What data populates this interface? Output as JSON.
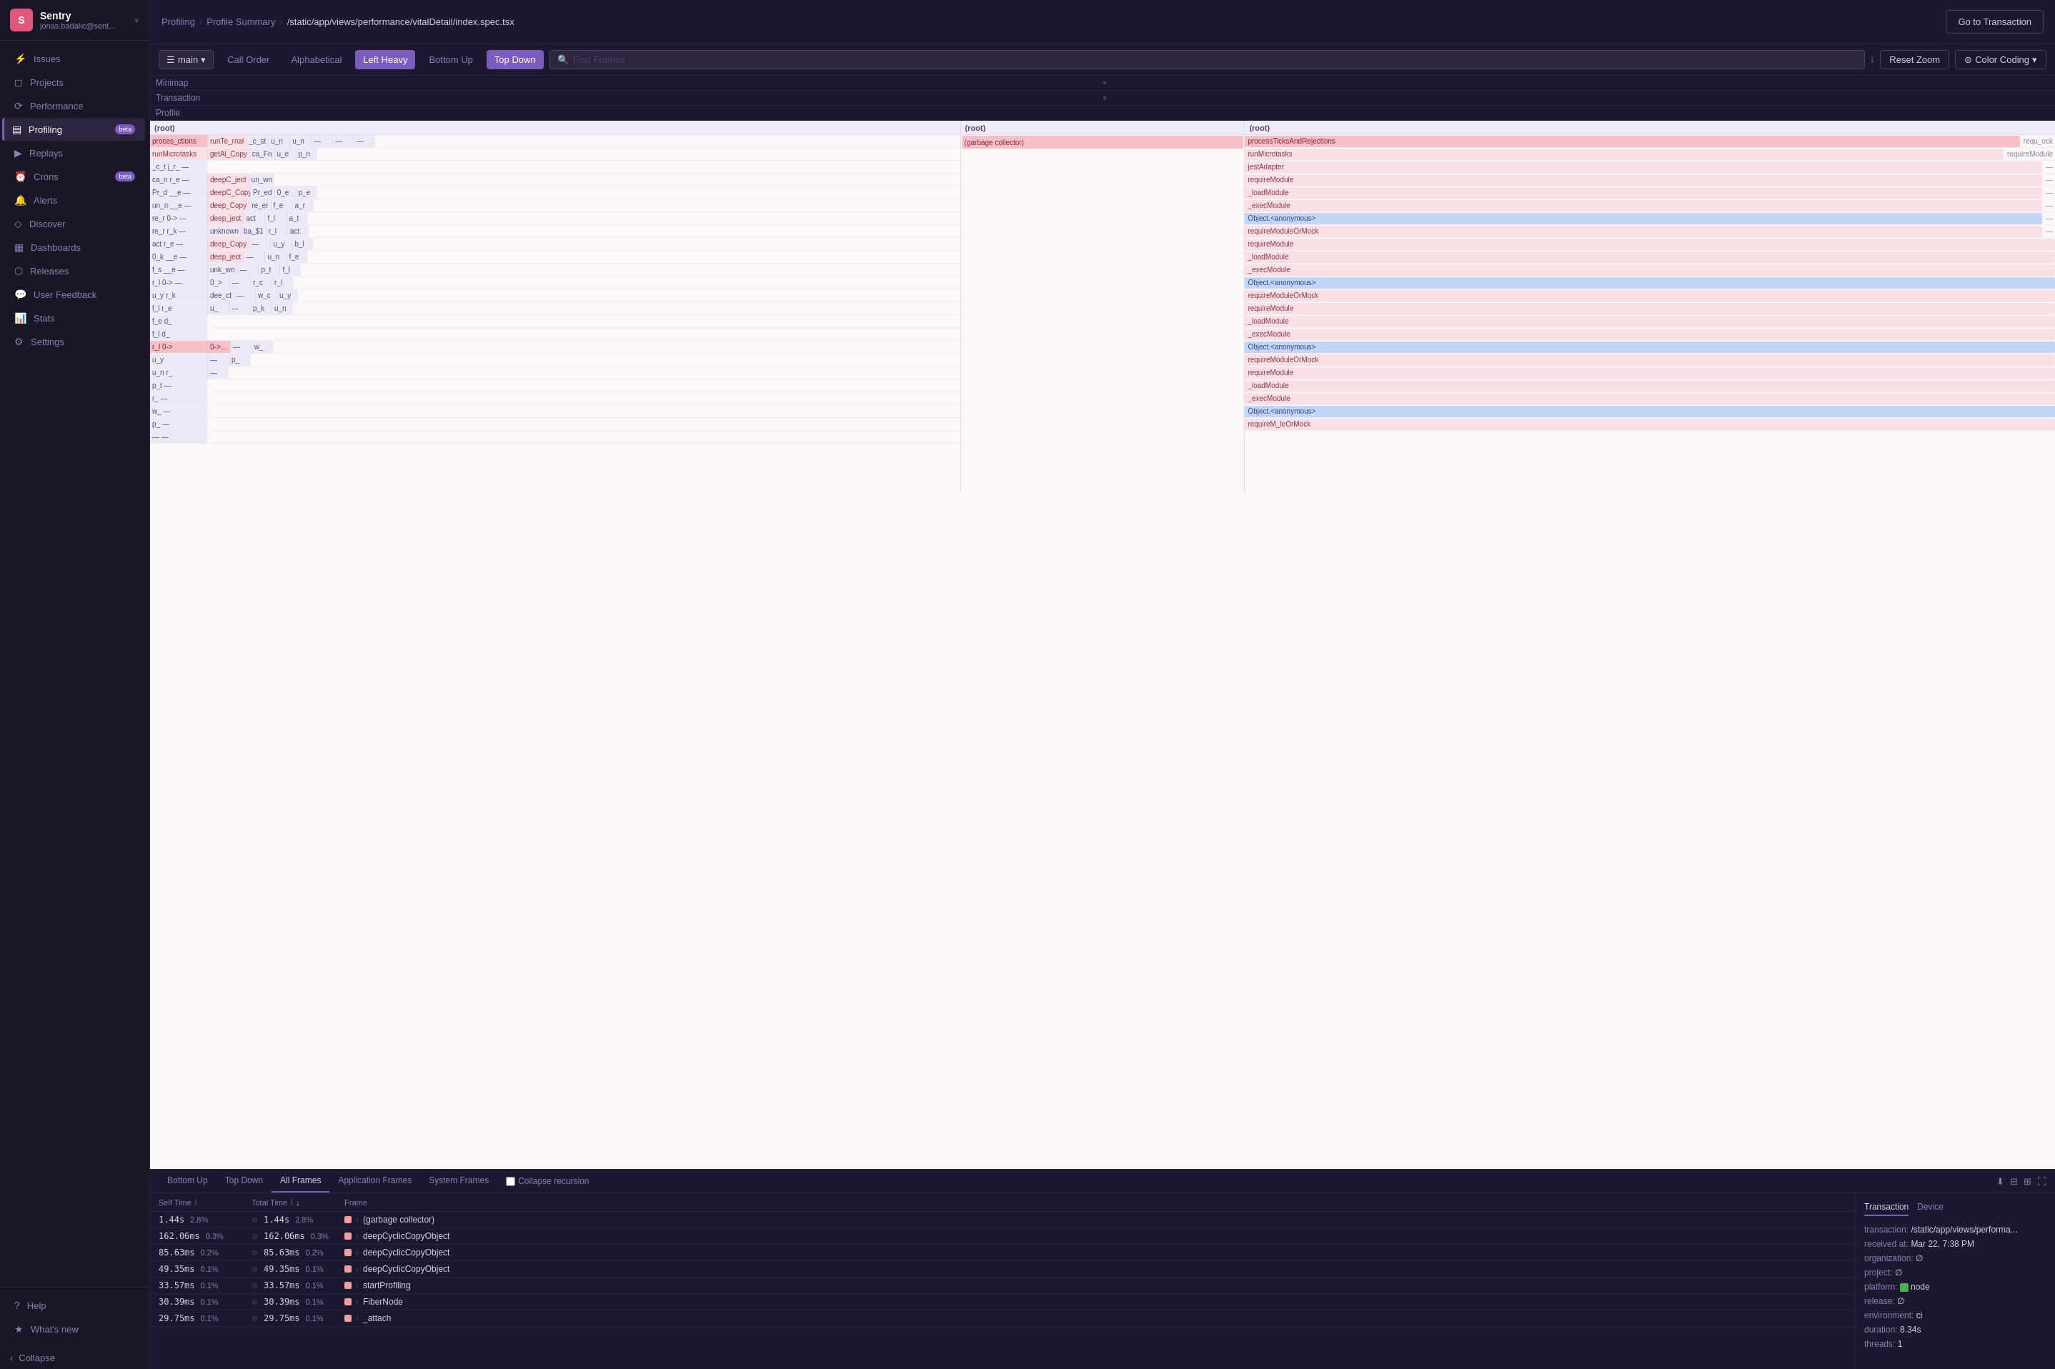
{
  "app": {
    "logo": "S",
    "org_name": "Sentry",
    "org_email": "jonas.badalic@sent..."
  },
  "sidebar": {
    "items": [
      {
        "id": "issues",
        "label": "Issues",
        "icon": "⚡",
        "active": false
      },
      {
        "id": "projects",
        "label": "Projects",
        "icon": "◻",
        "active": false
      },
      {
        "id": "performance",
        "label": "Performance",
        "icon": "⟳",
        "active": false
      },
      {
        "id": "profiling",
        "label": "Profiling",
        "icon": "▤",
        "active": true,
        "badge": "beta"
      },
      {
        "id": "replays",
        "label": "Replays",
        "icon": "▶",
        "active": false
      },
      {
        "id": "crons",
        "label": "Crons",
        "icon": "⏰",
        "active": false,
        "badge": "beta"
      },
      {
        "id": "alerts",
        "label": "Alerts",
        "icon": "🔔",
        "active": false
      },
      {
        "id": "discover",
        "label": "Discover",
        "icon": "◇",
        "active": false
      },
      {
        "id": "dashboards",
        "label": "Dashboards",
        "icon": "▦",
        "active": false
      },
      {
        "id": "releases",
        "label": "Releases",
        "icon": "⬡",
        "active": false
      },
      {
        "id": "user-feedback",
        "label": "User Feedback",
        "icon": "💬",
        "active": false
      },
      {
        "id": "stats",
        "label": "Stats",
        "icon": "📊",
        "active": false
      },
      {
        "id": "settings",
        "label": "Settings",
        "icon": "⚙",
        "active": false
      }
    ],
    "footer": [
      {
        "id": "help",
        "label": "Help",
        "icon": "?"
      },
      {
        "id": "whats-new",
        "label": "What's new",
        "icon": "★"
      }
    ],
    "collapse_label": "Collapse"
  },
  "breadcrumb": {
    "items": [
      "Profiling",
      "Profile Summary"
    ],
    "current": "/static/app/views/performance/vitalDetail/index.spec.tsx"
  },
  "goto_button": "Go to Transaction",
  "toolbar": {
    "select_value": "main",
    "buttons": [
      {
        "id": "call-order",
        "label": "Call Order",
        "active": false
      },
      {
        "id": "alphabetical",
        "label": "Alphabetical",
        "active": false
      },
      {
        "id": "left-heavy",
        "label": "Left Heavy",
        "active": true
      },
      {
        "id": "bottom-up",
        "label": "Bottom Up",
        "active": false
      },
      {
        "id": "top-down",
        "label": "Top Down",
        "active": true
      }
    ],
    "search_placeholder": "Find Frames",
    "reset_zoom": "Reset Zoom",
    "color_coding": "Color Coding"
  },
  "flamegraph_sections": [
    {
      "label": "Minimap",
      "expanded": true
    },
    {
      "label": "Transaction",
      "expanded": true
    },
    {
      "label": "Profile",
      "expanded": true
    }
  ],
  "flame_columns": [
    {
      "id": "col1",
      "header": "(root)",
      "rows": [
        {
          "label": "proces_ctions",
          "style": "fb-pink",
          "width": 95
        },
        {
          "label": "runMicrotasks",
          "style": "fb-light-pink",
          "width": 90
        },
        {
          "label": "_c_t j_r_",
          "style": "fb-gray",
          "width": 30
        },
        {
          "label": "ca_n r_e _",
          "style": "fb-gray",
          "width": 30
        },
        {
          "label": "Pr_d __e _",
          "style": "fb-gray",
          "width": 30
        },
        {
          "label": "un_n __e _",
          "style": "fb-gray",
          "width": 30
        },
        {
          "label": "re_r 0->",
          "style": "fb-gray",
          "width": 30
        },
        {
          "label": "re_r r_k _",
          "style": "fb-gray",
          "width": 30
        },
        {
          "label": "act r_e _",
          "style": "fb-gray",
          "width": 30
        },
        {
          "label": "0_k __e _",
          "style": "fb-gray",
          "width": 30
        },
        {
          "label": "f_s __e _",
          "style": "fb-gray",
          "width": 30
        },
        {
          "label": "r_l 0->",
          "style": "fb-gray",
          "width": 30
        },
        {
          "label": "u_y r_k",
          "style": "fb-gray",
          "width": 30
        },
        {
          "label": "f_l r_e",
          "style": "fb-gray",
          "width": 30
        },
        {
          "label": "f_e e_ d_",
          "style": "fb-gray",
          "width": 30
        },
        {
          "label": "f_l __e d_",
          "style": "fb-gray",
          "width": 30
        },
        {
          "label": "r_l 0->",
          "style": "fb-pink",
          "width": 60
        },
        {
          "label": "u_y r_k",
          "style": "fb-gray",
          "width": 30
        },
        {
          "label": "u_n r_ _",
          "style": "fb-gray",
          "width": 30
        },
        {
          "label": "p_t __",
          "style": "fb-gray",
          "width": 30
        },
        {
          "label": "r_ __",
          "style": "fb-gray",
          "width": 30
        },
        {
          "label": "w_ __",
          "style": "fb-gray",
          "width": 30
        },
        {
          "label": "p_ __",
          "style": "fb-gray",
          "width": 30
        },
        {
          "label": "__ __",
          "style": "fb-gray",
          "width": 30
        }
      ]
    },
    {
      "id": "col2",
      "header": "(root) (garbage collector)",
      "rows": [
        {
          "label": "(garbage collector)",
          "style": "fb-pink",
          "width": 95
        }
      ]
    },
    {
      "id": "col3",
      "header": "(root)",
      "rows": [
        {
          "label": "processTicksAndRejections",
          "style": "fb-pink",
          "width": 95
        },
        {
          "label": "runMicrotasks",
          "style": "fb-light-pink",
          "width": 90
        },
        {
          "label": "jestAdapter",
          "style": "fb-light-pink",
          "width": 85
        },
        {
          "label": "requireModule",
          "style": "fb-light-pink",
          "width": 80
        },
        {
          "label": "_loadModule",
          "style": "fb-light-pink",
          "width": 75
        },
        {
          "label": "_execModule",
          "style": "fb-light-pink",
          "width": 70
        },
        {
          "label": "Object.<anonymous>",
          "style": "fb-blue",
          "width": 65
        },
        {
          "label": "requireModuleOrMock",
          "style": "fb-light-pink",
          "width": 60
        },
        {
          "label": "requireModule",
          "style": "fb-light-pink",
          "width": 55
        },
        {
          "label": "_loadModule",
          "style": "fb-light-pink",
          "width": 50
        },
        {
          "label": "_execModule",
          "style": "fb-light-pink",
          "width": 48
        },
        {
          "label": "Object.<anonymous>",
          "style": "fb-blue",
          "width": 46
        },
        {
          "label": "requireModuleOrMock",
          "style": "fb-light-pink",
          "width": 44
        },
        {
          "label": "requireModule",
          "style": "fb-light-pink",
          "width": 42
        },
        {
          "label": "_loadModule",
          "style": "fb-light-pink",
          "width": 40
        },
        {
          "label": "_execModule",
          "style": "fb-light-pink",
          "width": 38
        },
        {
          "label": "Object.<anonymous>",
          "style": "fb-blue",
          "width": 36
        },
        {
          "label": "requireModuleOrMock",
          "style": "fb-light-pink",
          "width": 34
        },
        {
          "label": "requireModule",
          "style": "fb-light-pink",
          "width": 32
        },
        {
          "label": "_loadModule",
          "style": "fb-light-pink",
          "width": 30
        },
        {
          "label": "_execModule",
          "style": "fb-light-pink",
          "width": 28
        },
        {
          "label": "Object.<anonymous>",
          "style": "fb-blue",
          "width": 26
        },
        {
          "label": "requireM_leOrMock",
          "style": "fb-light-pink",
          "width": 24
        }
      ]
    }
  ],
  "bottom_tabs": [
    {
      "id": "bottom-up",
      "label": "Bottom Up",
      "active": false
    },
    {
      "id": "top-down",
      "label": "Top Down",
      "active": false
    },
    {
      "id": "all-frames",
      "label": "All Frames",
      "active": true
    },
    {
      "id": "application-frames",
      "label": "Application Frames",
      "active": false
    },
    {
      "id": "system-frames",
      "label": "System Frames",
      "active": false
    }
  ],
  "collapse_recursion_label": "Collapse recursion",
  "table_headers": {
    "self_time": "Self Time",
    "total_time": "Total Time",
    "frame": "Frame"
  },
  "table_rows": [
    {
      "self_time": "1.44s",
      "self_pct": "2.8%",
      "total_time": "1.44s",
      "total_pct": "2.8%",
      "frame": "(garbage collector)",
      "color": "#f5a0a0",
      "expandable": true
    },
    {
      "self_time": "162.06ms",
      "self_pct": "0.3%",
      "total_time": "162.06ms",
      "total_pct": "0.3%",
      "frame": "deepCyclicCopyObject",
      "color": "#f5a0a0",
      "expandable": true
    },
    {
      "self_time": "85.63ms",
      "self_pct": "0.2%",
      "total_time": "85.63ms",
      "total_pct": "0.2%",
      "frame": "deepCyclicCopyObject",
      "color": "#f5a0a0",
      "expandable": true
    },
    {
      "self_time": "49.35ms",
      "self_pct": "0.1%",
      "total_time": "49.35ms",
      "total_pct": "0.1%",
      "frame": "deepCyclicCopyObject",
      "color": "#f5a0a0",
      "expandable": true
    },
    {
      "self_time": "33.57ms",
      "self_pct": "0.1%",
      "total_time": "33.57ms",
      "total_pct": "0.1%",
      "frame": "startProfiling",
      "color": "#f5a0a0",
      "expandable": true
    },
    {
      "self_time": "30.39ms",
      "self_pct": "0.1%",
      "total_time": "30.39ms",
      "total_pct": "0.1%",
      "frame": "FiberNode",
      "color": "#f5a0a0",
      "expandable": true
    },
    {
      "self_time": "29.75ms",
      "self_pct": "0.1%",
      "total_time": "29.75ms",
      "total_pct": "0.1%",
      "frame": "_attach",
      "color": "#f5a0a0",
      "expandable": true
    }
  ],
  "side_panel": {
    "tabs": [
      "Transaction",
      "Device"
    ],
    "active_tab": "Transaction",
    "fields": [
      {
        "key": "transaction:",
        "value": "/static/app/views/performa..."
      },
      {
        "key": "received at:",
        "value": "Mar 22, 7:38 PM"
      },
      {
        "key": "organization:",
        "value": "∅"
      },
      {
        "key": "project:",
        "value": "∅"
      },
      {
        "key": "platform:",
        "value": "node",
        "has_icon": true
      },
      {
        "key": "release:",
        "value": "∅"
      },
      {
        "key": "environment:",
        "value": "ci"
      },
      {
        "key": "duration:",
        "value": "8.34s"
      },
      {
        "key": "threads:",
        "value": "1"
      }
    ]
  },
  "icons": {
    "chevron_down": "▾",
    "chevron_right": "›",
    "expand": "⊕",
    "sort_asc": "↑",
    "sort_desc": "↓",
    "gear": "⚙",
    "search": "🔍",
    "info": "ℹ",
    "download": "⬇",
    "split_h": "⊟",
    "split_v": "⊞",
    "fullscreen": "⛶",
    "filter": "⊜"
  }
}
